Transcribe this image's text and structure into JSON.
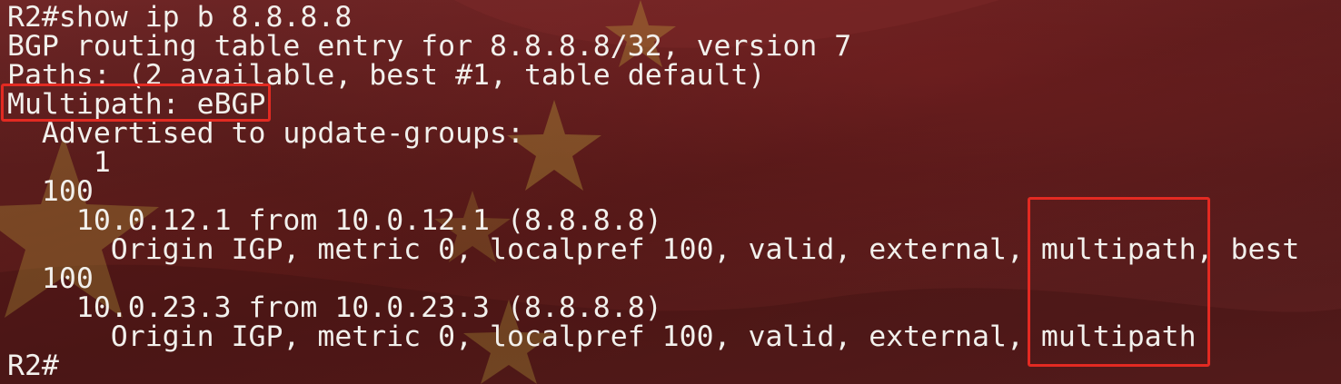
{
  "terminal": {
    "lines": [
      "R2#show ip b 8.8.8.8",
      "BGP routing table entry for 8.8.8.8/32, version 7",
      "Paths: (2 available, best #1, table default)",
      "Multipath: eBGP",
      "  Advertised to update-groups:",
      "     1",
      "  100",
      "    10.0.12.1 from 10.0.12.1 (8.8.8.8)",
      "      Origin IGP, metric 0, localpref 100, valid, external, multipath, best",
      "  100",
      "    10.0.23.3 from 10.0.23.3 (8.8.8.8)",
      "      Origin IGP, metric 0, localpref 100, valid, external, multipath",
      "R2#"
    ]
  },
  "colors": {
    "text": "#f2f0ec",
    "highlight_border": "#e32a22",
    "background": "#5a1c1c",
    "flag_star": "#c9b640"
  }
}
